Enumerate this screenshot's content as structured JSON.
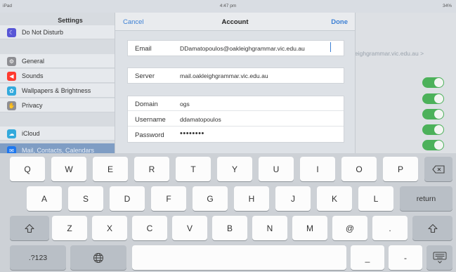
{
  "status_bar": {
    "device": "iPad",
    "time": "4:47 pm",
    "battery": "34%"
  },
  "sidebar": {
    "title": "Settings",
    "items": [
      {
        "label": "Do Not Disturb",
        "icon": "moon-icon",
        "color": "#5856d6",
        "selected": false
      },
      {
        "label": "General",
        "icon": "gear-icon",
        "color": "#8e8e93",
        "selected": false
      },
      {
        "label": "Sounds",
        "icon": "speaker-icon",
        "color": "#ff3b30",
        "selected": false
      },
      {
        "label": "Wallpapers & Brightness",
        "icon": "flower-icon",
        "color": "#34aadc",
        "selected": false
      },
      {
        "label": "Privacy",
        "icon": "hand-icon",
        "color": "#8e8e93",
        "selected": false
      },
      {
        "label": "iCloud",
        "icon": "cloud-icon",
        "color": "#34aadc",
        "selected": false
      },
      {
        "label": "Mail, Contacts, Calendars",
        "icon": "mail-icon",
        "color": "#1d77ef",
        "selected": true
      }
    ]
  },
  "background": {
    "email_faded": "eighgrammar.vic.edu.au  >"
  },
  "modal": {
    "cancel_label": "Cancel",
    "title": "Account",
    "done_label": "Done",
    "groups": [
      {
        "fields": [
          {
            "label": "Email",
            "value": "DDamatopoulos@oakleighgrammar.vic.edu.au"
          }
        ]
      },
      {
        "fields": [
          {
            "label": "Server",
            "value": "mail.oakleighgrammar.vic.edu.au"
          }
        ]
      },
      {
        "fields": [
          {
            "label": "Domain",
            "value": "ogs"
          },
          {
            "label": "Username",
            "value": "ddamatopoulos"
          },
          {
            "label": "Password",
            "value": "••••••••"
          }
        ]
      }
    ]
  },
  "keyboard": {
    "row1": [
      "Q",
      "W",
      "E",
      "R",
      "T",
      "Y",
      "U",
      "I",
      "O",
      "P"
    ],
    "row2": [
      "A",
      "S",
      "D",
      "F",
      "G",
      "H",
      "J",
      "K",
      "L"
    ],
    "row2_return": "return",
    "row3": [
      "Z",
      "X",
      "C",
      "V",
      "B",
      "N",
      "M",
      "@",
      "."
    ],
    "row4_numbers": ".?123",
    "row4_underscore": "_",
    "row4_dash": "-",
    "icons": {
      "backspace": "backspace-icon",
      "shift": "shift-icon",
      "globe": "globe-icon",
      "dismiss": "keyboard-dismiss-icon"
    }
  },
  "colors": {
    "accent": "#3b7fd4",
    "toggle_on": "#4cb15a",
    "sidebar_selected": "#7f9dc4"
  }
}
